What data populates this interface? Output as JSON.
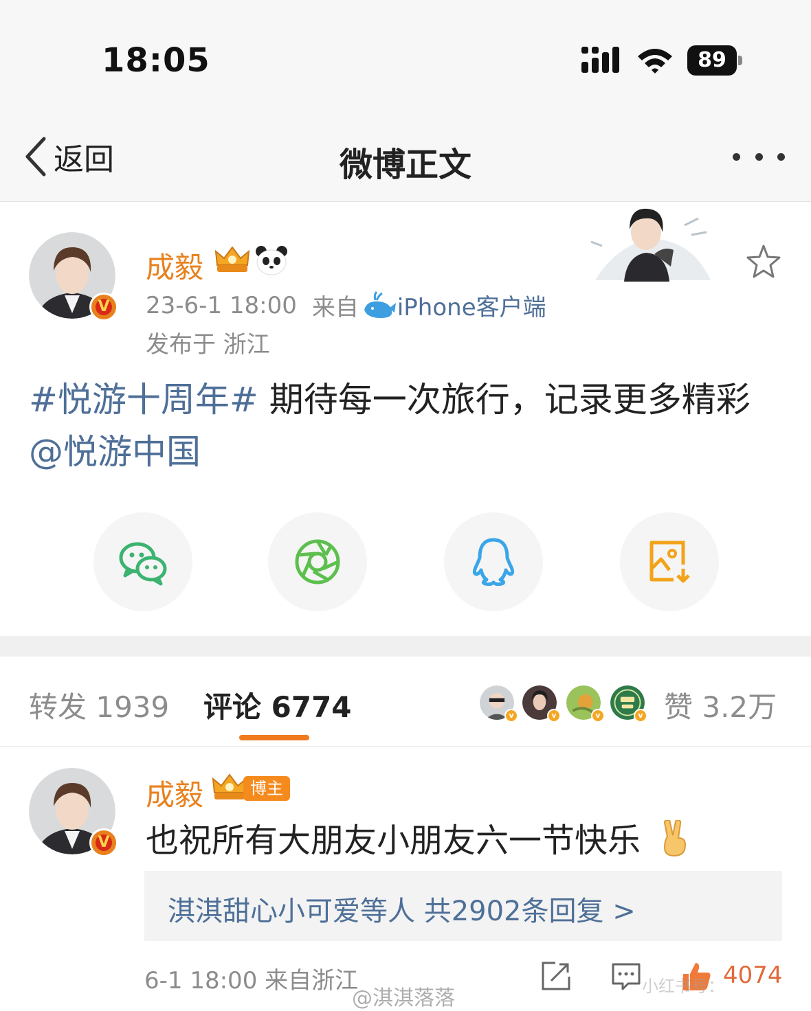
{
  "status_bar": {
    "time": "18:05",
    "battery": "89"
  },
  "nav": {
    "back_label": "返回",
    "title": "微博正文"
  },
  "post": {
    "author": "成毅",
    "time": "23-6-1 18:00",
    "from_prefix": "来自",
    "source": "iPhone客户端",
    "location": "发布于 浙江",
    "hashtag": "#悦游十周年#",
    "body": " 期待每一次旅行，记录更多精彩 ",
    "mention": "@悦游中国"
  },
  "share": {
    "icons": [
      "wechat-icon",
      "moments-icon",
      "qq-icon",
      "save-image-icon"
    ],
    "colors": {
      "wechat": "#3cb371",
      "moments": "#5cbf4e",
      "qq": "#3aa5e8",
      "save": "#f2a31a"
    }
  },
  "tabs": {
    "repost": "转发 1939",
    "comment": "评论 6774",
    "likes": "赞 3.2万"
  },
  "comment": {
    "author": "成毅",
    "badge": "博主",
    "text": "也祝所有大朋友小朋友六一节快乐",
    "reply_summary": "淇淇甜心小可爱等人  共2902条回复 >",
    "meta": "6-1 18:00  来自浙江",
    "like_count": "4074"
  },
  "watermark": "@淇淇落落",
  "watermark2": "小红书号：",
  "colors": {
    "accent": "#e8811d",
    "link": "#4e6f98",
    "underline": "#f07a1e"
  }
}
